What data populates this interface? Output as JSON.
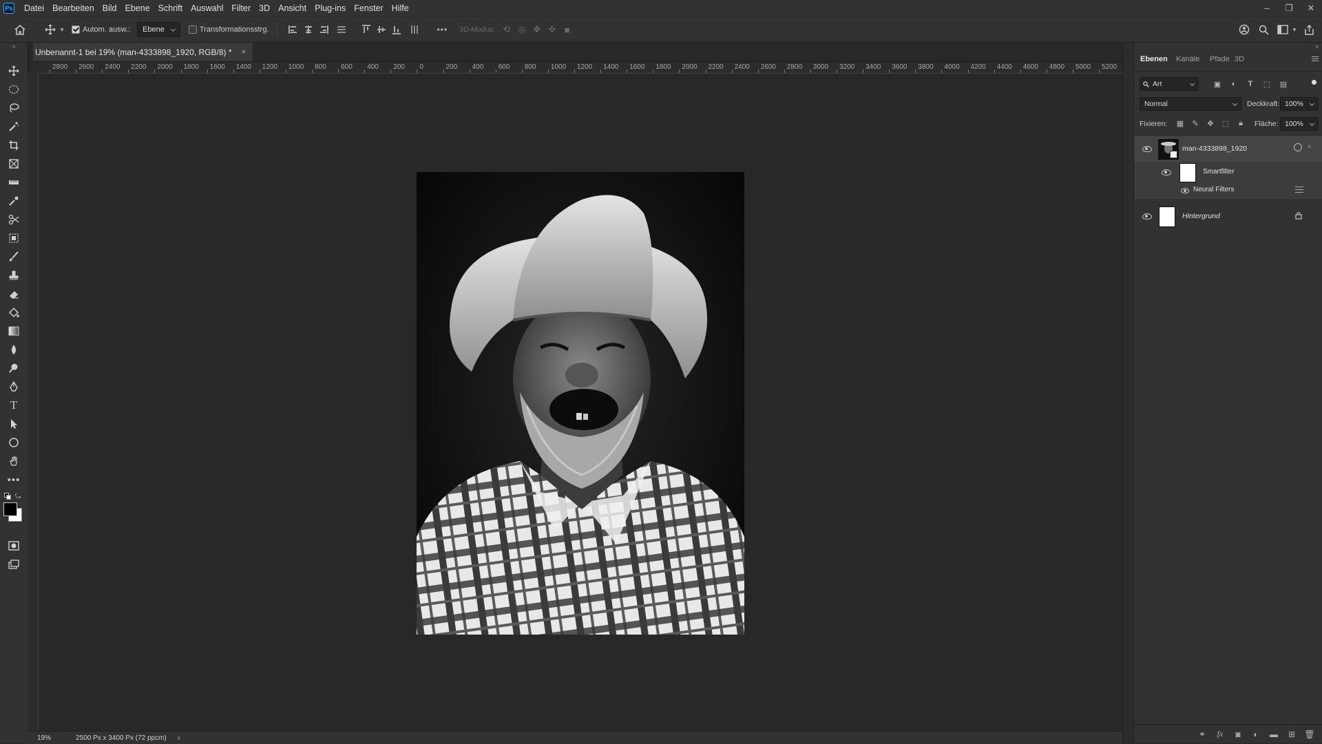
{
  "app": {
    "logo": "Ps"
  },
  "menu": [
    "Datei",
    "Bearbeiten",
    "Bild",
    "Ebene",
    "Schrift",
    "Auswahl",
    "Filter",
    "3D",
    "Ansicht",
    "Plug-ins",
    "Fenster",
    "Hilfe"
  ],
  "window_controls": {
    "minimize": "–",
    "restore": "❐",
    "close": "✕"
  },
  "options": {
    "auto_select_label": "Autom. ausw.:",
    "auto_select_target": "Ebene",
    "transform_label": "Transformationsstrg.",
    "more_label": "•••",
    "mode_3d_label": "3D-Modus:"
  },
  "document": {
    "tab_title": "Unbenannt-1 bei 19% (man-4333898_1920, RGB/8) *",
    "close": "×"
  },
  "ruler": {
    "top_labels": [
      "2800",
      "2600",
      "2400",
      "2200",
      "2000",
      "1800",
      "1600",
      "1400",
      "1200",
      "1000",
      "800",
      "600",
      "400",
      "200",
      "0",
      "200",
      "400",
      "600",
      "800",
      "1000",
      "1200",
      "1400",
      "1600",
      "1800",
      "2000",
      "2200",
      "2400",
      "2600",
      "2800",
      "3000",
      "3200",
      "3400",
      "3600",
      "3800",
      "4000",
      "4200",
      "4400",
      "4600",
      "4800",
      "5000",
      "5200"
    ]
  },
  "status": {
    "zoom": "19%",
    "doc_info": "2500 Px x 3400 Px (72 ppcm)",
    "arrow": "›"
  },
  "panel": {
    "tabs": [
      "Ebenen",
      "Kanäle",
      "Pfade",
      "3D"
    ],
    "filter_kind": "Art",
    "blend_mode": "Normal",
    "opacity_label": "Deckkraft:",
    "opacity_value": "100%",
    "lock_label": "Fixieren:",
    "fill_label": "Fläche:",
    "fill_value": "100%",
    "layers": [
      {
        "name": "man-4333898_1920"
      },
      {
        "name": "Smartfilter"
      },
      {
        "name": "Neural Filters"
      },
      {
        "name": "Hintergrund"
      }
    ]
  },
  "colors": {
    "accent": "#31a8ff",
    "ui_dark": "#323232",
    "canvas_bg": "#282828"
  }
}
